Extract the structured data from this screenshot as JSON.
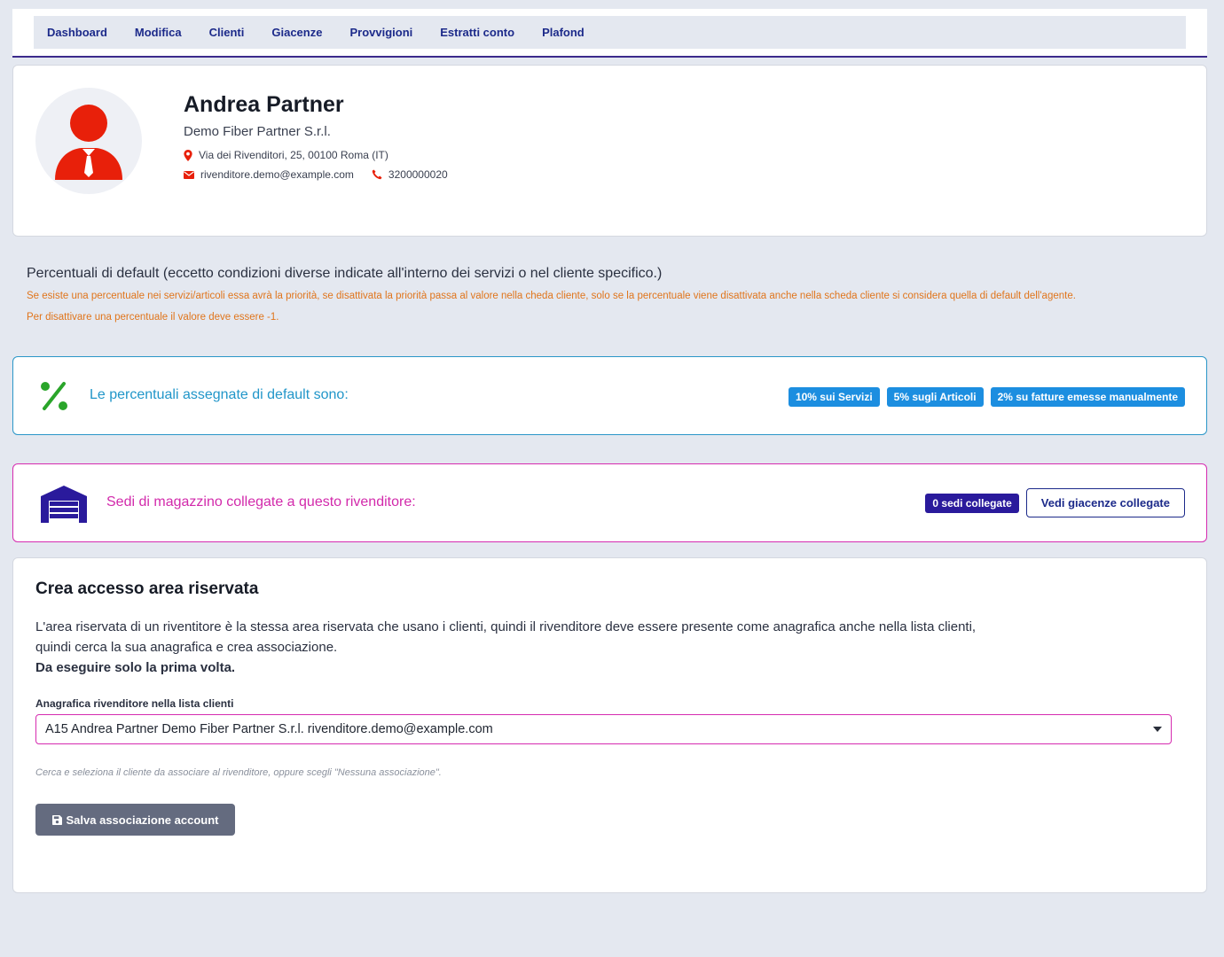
{
  "nav": {
    "tabs": [
      "Dashboard",
      "Modifica",
      "Clienti",
      "Giacenze",
      "Provvigioni",
      "Estratti conto",
      "Plafond"
    ]
  },
  "profile": {
    "name": "Andrea Partner",
    "company": "Demo Fiber Partner S.r.l.",
    "address": "Via dei Rivenditori, 25, 00100 Roma (IT)",
    "email": "rivenditore.demo@example.com",
    "phone": "3200000020"
  },
  "info": {
    "title": "Percentuali di default (eccetto condizioni diverse indicate all'interno dei servizi o nel cliente specifico.)",
    "warning1": "Se esiste una percentuale nei servizi/articoli essa avrà la priorità, se disattivata la priorità passa al valore nella cheda cliente, solo se la percentuale viene disattivata anche nella scheda cliente si considera quella di default dell'agente.",
    "warning2": "Per disattivare una percentuale il valore deve essere -1."
  },
  "percent": {
    "text": "Le percentuali assegnate di default sono:",
    "badges": [
      "10% sui Servizi",
      "5% sugli Articoli",
      "2% su fatture emesse manualmente"
    ]
  },
  "warehouse": {
    "text": "Sedi di magazzino collegate a questo rivenditore:",
    "count_badge": "0 sedi collegate",
    "button": "Vedi giacenze collegate"
  },
  "access": {
    "title": "Crea accesso area riservata",
    "desc_line1": "L'area riservata di un riventitore è la stessa area riservata che usano i clienti, quindi il rivenditore deve essere presente come anagrafica anche nella lista clienti,",
    "desc_line2": "quindi cerca la sua anagrafica e crea associazione.",
    "desc_bold": "Da eseguire solo la prima volta.",
    "field_label": "Anagrafica rivenditore nella lista clienti",
    "select_value": "A15 Andrea Partner Demo Fiber Partner S.r.l. rivenditore.demo@example.com",
    "help": "Cerca e seleziona il cliente da associare al rivenditore, oppure scegli \"Nessuna associazione\".",
    "save_button": "Salva associazione account"
  },
  "colors": {
    "nav_text": "#1c2a8a",
    "avatar_red": "#e8200a",
    "warning_orange": "#e0751c",
    "percent_blue": "#2196c9",
    "badge_blue": "#1c8ee0",
    "warehouse_magenta": "#d22aab",
    "warehouse_icon": "#2a1a9c",
    "save_button": "#646b7f"
  },
  "icons": [
    "user-avatar-icon",
    "map-marker-icon",
    "envelope-icon",
    "phone-icon",
    "percent-icon",
    "warehouse-icon",
    "save-icon",
    "caret-down-icon"
  ]
}
